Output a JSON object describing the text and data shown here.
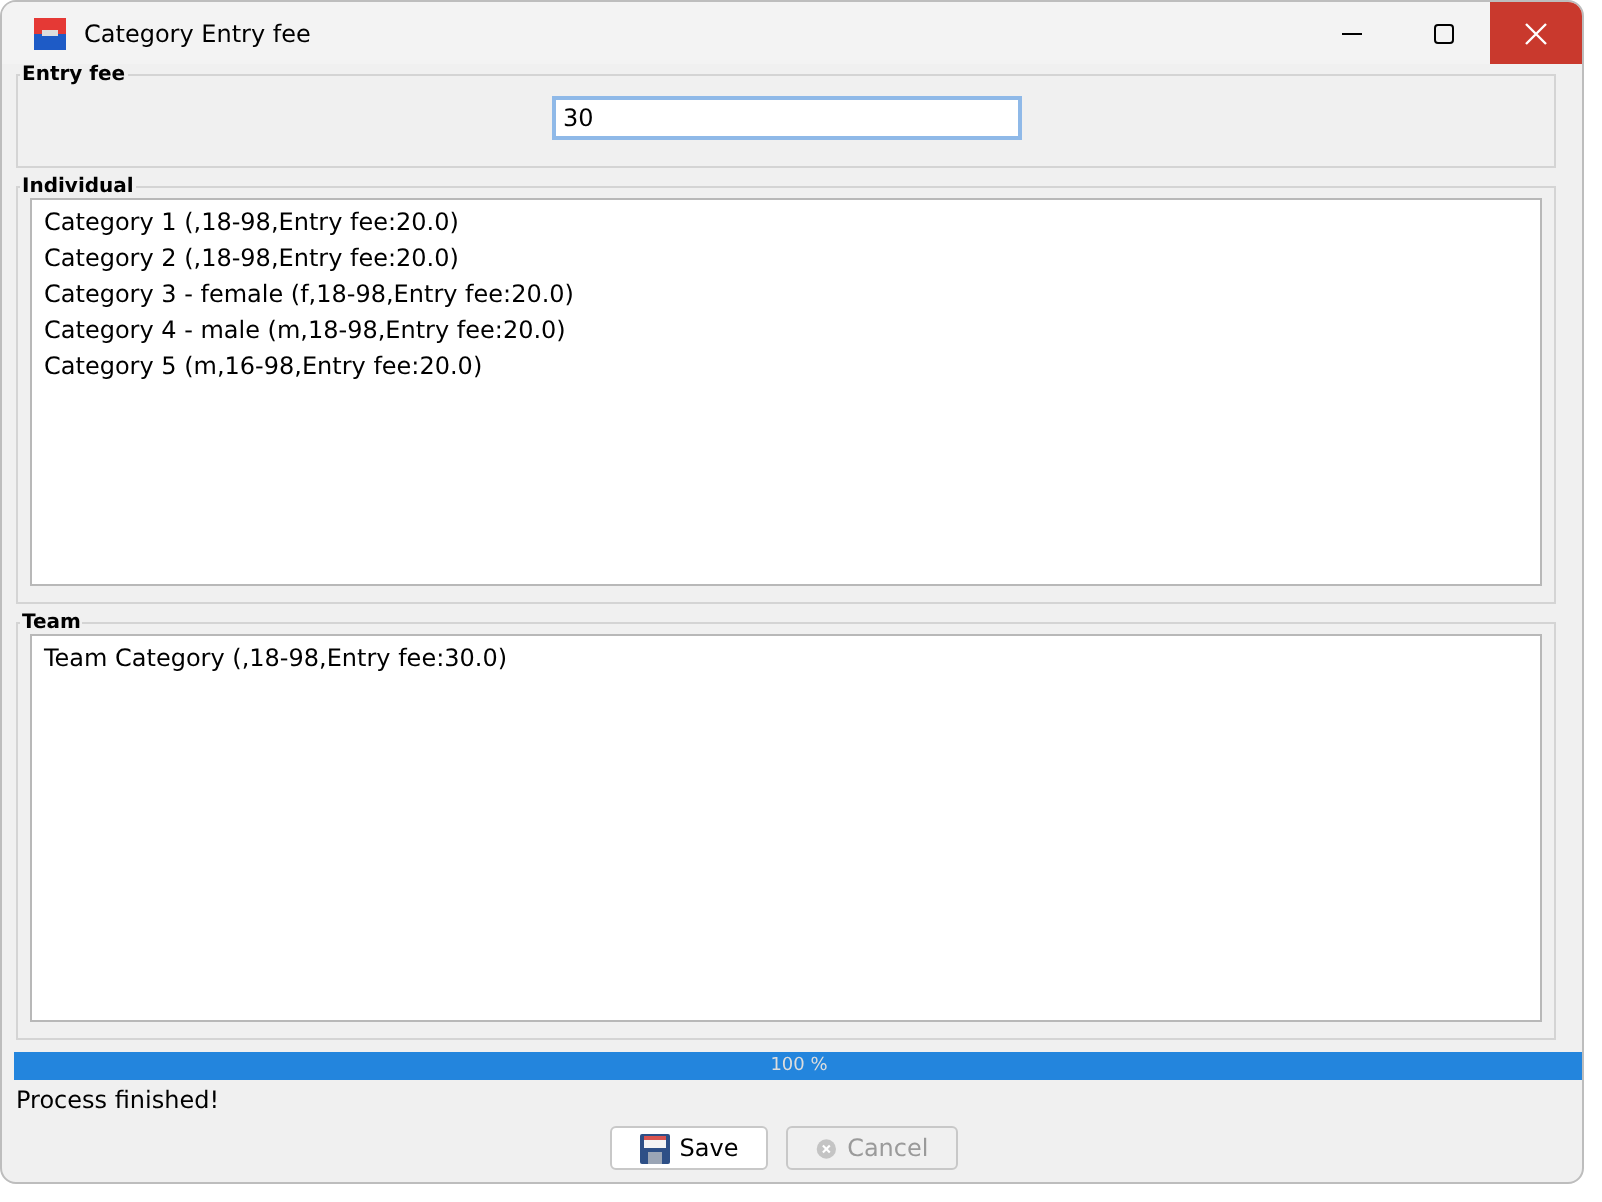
{
  "window": {
    "title": "Category Entry fee"
  },
  "entry_fee": {
    "label": "Entry fee",
    "value": "30"
  },
  "individual": {
    "label": "Individual",
    "items": [
      "Category 1 (,18-98,Entry fee:20.0)",
      "Category 2 (,18-98,Entry fee:20.0)",
      "Category 3 - female (f,18-98,Entry fee:20.0)",
      "Category 4 - male (m,18-98,Entry fee:20.0)",
      "Category 5 (m,16-98,Entry fee:20.0)"
    ]
  },
  "team": {
    "label": "Team",
    "items": [
      "Team Category (,18-98,Entry fee:30.0)"
    ]
  },
  "progress": {
    "level": 1,
    "text": "100 %"
  },
  "status": "Process finished!",
  "buttons": [
    {
      "label": "Save",
      "kind": "save",
      "disabled": false
    },
    {
      "label": "Cancel",
      "kind": "cancel",
      "disabled": true
    }
  ]
}
